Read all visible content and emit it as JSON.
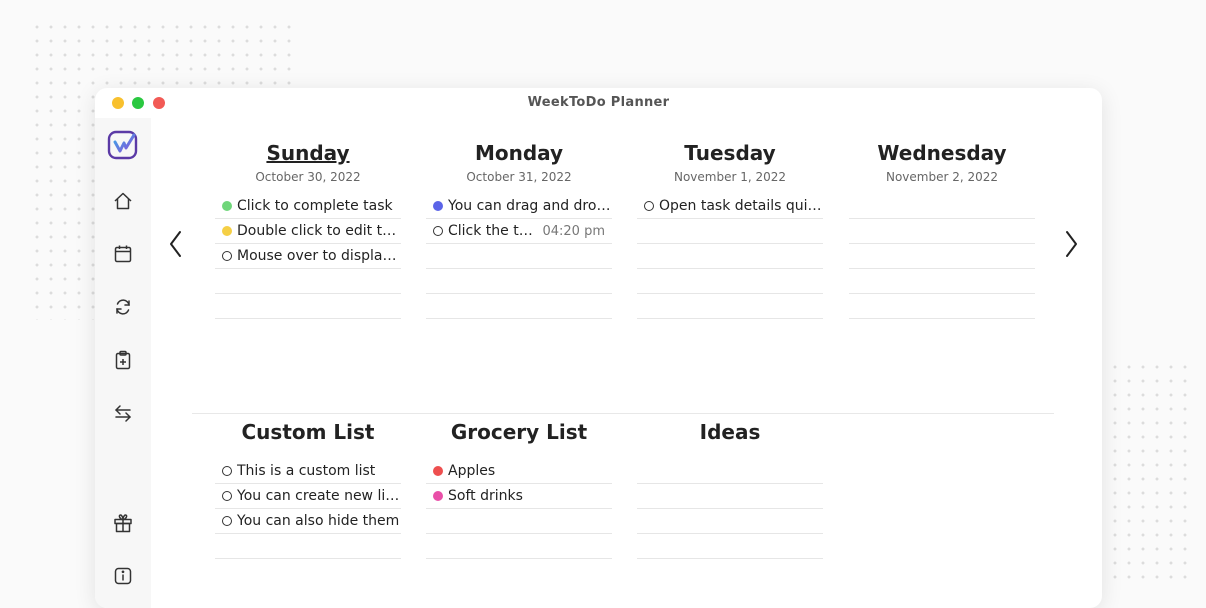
{
  "window": {
    "title": "WeekToDo Planner"
  },
  "sidebar": {
    "items": [
      {
        "name": "home-icon"
      },
      {
        "name": "calendar-icon"
      },
      {
        "name": "sync-icon"
      },
      {
        "name": "add-list-icon"
      },
      {
        "name": "swap-icon"
      },
      {
        "name": "gift-icon"
      },
      {
        "name": "info-icon"
      }
    ]
  },
  "days": [
    {
      "name": "Sunday",
      "date": "October 30, 2022",
      "today": true,
      "tasks": [
        {
          "text": "Click to complete task",
          "color": "#6fd67a",
          "time": ""
        },
        {
          "text": "Double click to edit task",
          "color": "#f5cf45",
          "time": ""
        },
        {
          "text": "Mouse over to display more options",
          "color": "",
          "time": ""
        },
        {
          "text": "",
          "color": "",
          "time": ""
        },
        {
          "text": "",
          "color": "",
          "time": ""
        }
      ]
    },
    {
      "name": "Monday",
      "date": "October 31, 2022",
      "today": false,
      "tasks": [
        {
          "text": "You can drag and drop tasks",
          "color": "#5b64e8",
          "time": ""
        },
        {
          "text": "Click the three dots",
          "color": "",
          "time": "04:20 pm"
        },
        {
          "text": "",
          "color": "",
          "time": ""
        },
        {
          "text": "",
          "color": "",
          "time": ""
        },
        {
          "text": "",
          "color": "",
          "time": ""
        }
      ]
    },
    {
      "name": "Tuesday",
      "date": "November 1, 2022",
      "today": false,
      "tasks": [
        {
          "text": "Open task details quickly",
          "color": "",
          "time": ""
        },
        {
          "text": "",
          "color": "",
          "time": ""
        },
        {
          "text": "",
          "color": "",
          "time": ""
        },
        {
          "text": "",
          "color": "",
          "time": ""
        },
        {
          "text": "",
          "color": "",
          "time": ""
        }
      ]
    },
    {
      "name": "Wednesday",
      "date": "November 2, 2022",
      "today": false,
      "tasks": [
        {
          "text": "",
          "color": "",
          "time": ""
        },
        {
          "text": "",
          "color": "",
          "time": ""
        },
        {
          "text": "",
          "color": "",
          "time": ""
        },
        {
          "text": "",
          "color": "",
          "time": ""
        },
        {
          "text": "",
          "color": "",
          "time": ""
        }
      ]
    }
  ],
  "lists": [
    {
      "name": "Custom List",
      "tasks": [
        {
          "text": "This is a custom list",
          "color": "",
          "time": ""
        },
        {
          "text": "You can create new lists",
          "color": "",
          "time": ""
        },
        {
          "text": "You can also hide them",
          "color": "",
          "time": ""
        },
        {
          "text": "",
          "color": "",
          "time": ""
        }
      ]
    },
    {
      "name": "Grocery List",
      "tasks": [
        {
          "text": "Apples",
          "color": "#ee4f4f",
          "time": ""
        },
        {
          "text": "Soft drinks",
          "color": "#e94fa8",
          "time": ""
        },
        {
          "text": "",
          "color": "",
          "time": ""
        },
        {
          "text": "",
          "color": "",
          "time": ""
        }
      ]
    },
    {
      "name": "Ideas",
      "tasks": [
        {
          "text": "",
          "color": "",
          "time": ""
        },
        {
          "text": "",
          "color": "",
          "time": ""
        },
        {
          "text": "",
          "color": "",
          "time": ""
        },
        {
          "text": "",
          "color": "",
          "time": ""
        }
      ]
    }
  ],
  "nav": {
    "prev": "chevron-left-icon",
    "next": "chevron-right-icon"
  }
}
